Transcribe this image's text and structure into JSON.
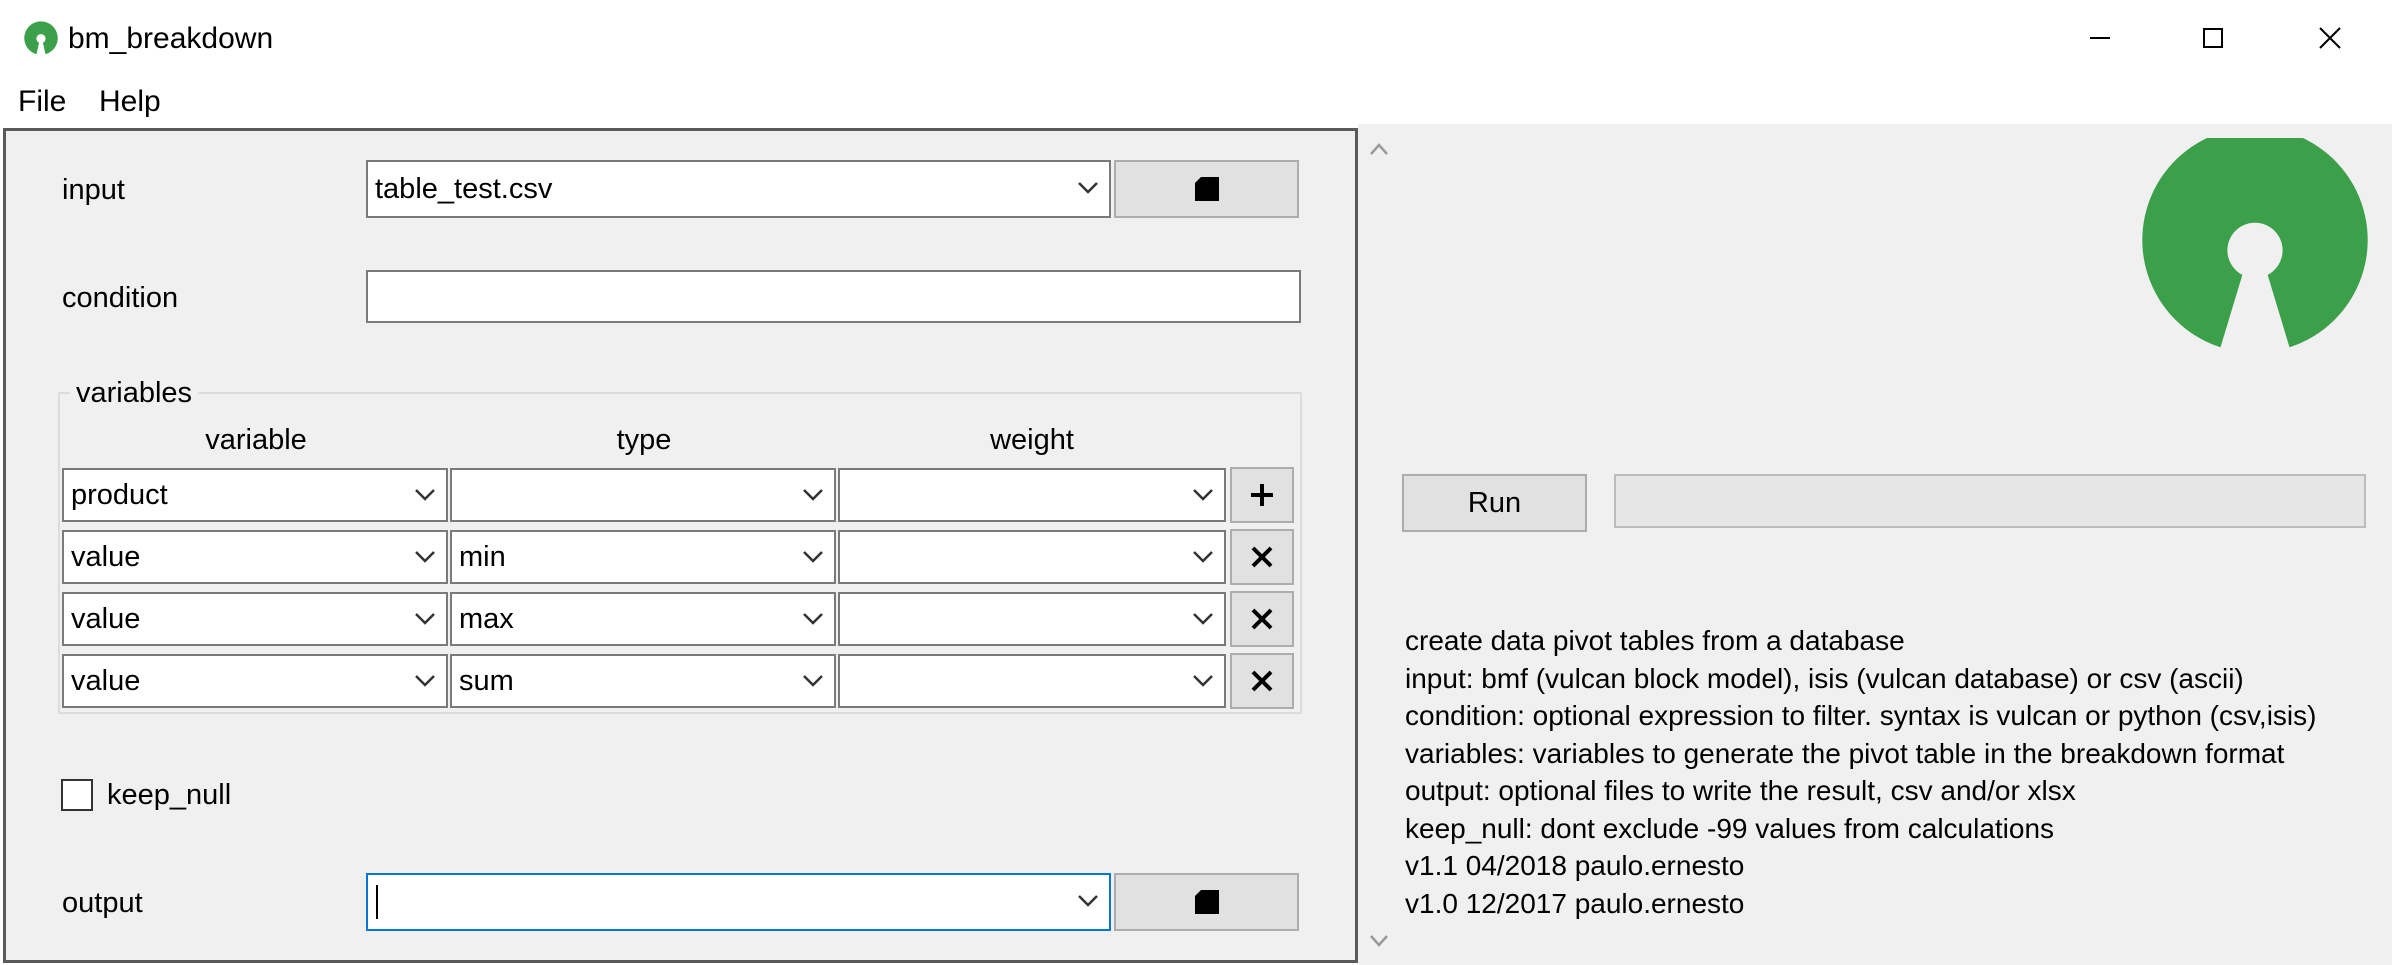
{
  "window": {
    "title": "bm_breakdown",
    "app_icon": "open-source-logo-icon",
    "controls": {
      "minimize": "minimize-icon",
      "maximize": "maximize-icon",
      "close": "close-icon"
    }
  },
  "menu": [
    {
      "label": "File"
    },
    {
      "label": "Help"
    }
  ],
  "form": {
    "input_label": "input",
    "input_value": "table_test.csv",
    "condition_label": "condition",
    "condition_value": "",
    "variables_title": "variables",
    "columns": [
      "variable",
      "type",
      "weight"
    ],
    "rows": [
      {
        "variable": "product",
        "type": "",
        "weight": "",
        "action": "plus-icon"
      },
      {
        "variable": "value",
        "type": "min",
        "weight": "",
        "action": "close-icon"
      },
      {
        "variable": "value",
        "type": "max",
        "weight": "",
        "action": "close-icon"
      },
      {
        "variable": "value",
        "type": "sum",
        "weight": "",
        "action": "close-icon"
      }
    ],
    "keep_null_label": "keep_null",
    "keep_null_checked": false,
    "output_label": "output",
    "output_value": "",
    "browse_icon": "file-icon"
  },
  "run": {
    "label": "Run",
    "progress": 0
  },
  "help_lines": [
    "create data pivot tables from a database",
    "input: bmf (vulcan block model), isis (vulcan database) or  csv (ascii)",
    "condition: optional expression to filter. syntax is vulcan or python (csv,isis)",
    "variables: variables to generate the pivot table in the breakdown format",
    "output: optional files to write the result, csv and/or xlsx",
    "keep_null: dont exclude -99 values from calculations",
    "v1.1 04/2018 paulo.ernesto",
    "v1.0 12/2017 paulo.ernesto"
  ],
  "colors": {
    "logo_green": "#3ca04a",
    "focus_blue": "#0078d7"
  }
}
